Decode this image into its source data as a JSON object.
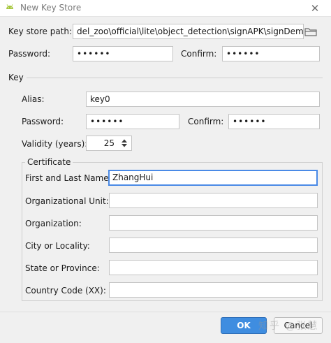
{
  "window": {
    "title": "New Key Store",
    "icon": "android-icon",
    "close_glyph": "✕"
  },
  "keystore": {
    "path_label": "Key store path:",
    "path_value": "del_zoo\\official\\lite\\object_detection\\signAPK\\signDemo.jks",
    "password_label": "Password:",
    "password_value": "••••••",
    "confirm_label": "Confirm:",
    "confirm_value": "••••••"
  },
  "key": {
    "section_label": "Key",
    "alias_label": "Alias:",
    "alias_value": "key0",
    "password_label": "Password:",
    "password_value": "••••••",
    "confirm_label": "Confirm:",
    "confirm_value": "••••••",
    "validity_label": "Validity (years):",
    "validity_value": "25"
  },
  "certificate": {
    "section_label": "Certificate",
    "fields": [
      {
        "label": "First and Last Name:",
        "value": "ZhangHui"
      },
      {
        "label": "Organizational Unit:",
        "value": ""
      },
      {
        "label": "Organization:",
        "value": ""
      },
      {
        "label": "City or Locality:",
        "value": ""
      },
      {
        "label": "State or Province:",
        "value": ""
      },
      {
        "label": "Country Code (XX):",
        "value": ""
      }
    ]
  },
  "buttons": {
    "ok_label": "OK",
    "cancel_label": "Cancel"
  },
  "watermark": "知乎 @张慧",
  "colors": {
    "accent": "#3f8de0",
    "focus": "#4a8ae6",
    "android": "#a4c639"
  }
}
